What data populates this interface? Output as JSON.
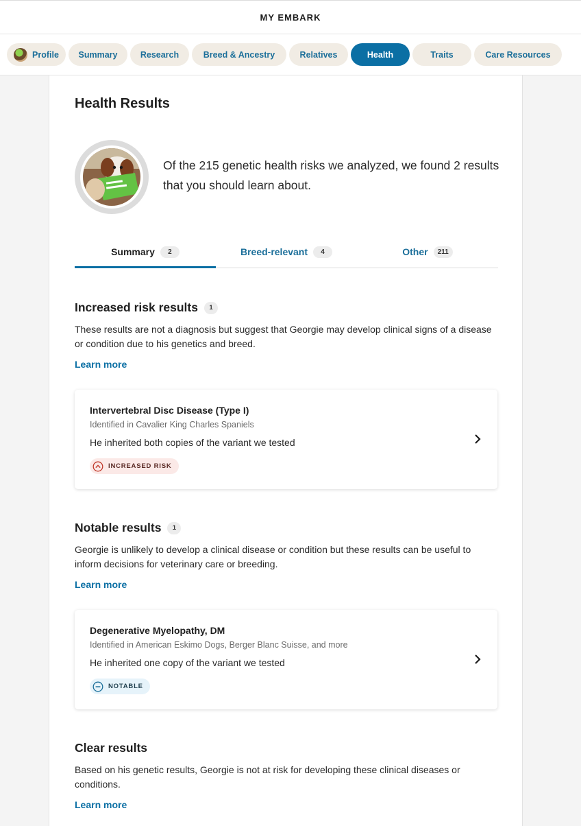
{
  "header": {
    "title": "MY EMBARK"
  },
  "nav": {
    "items": [
      {
        "label": "Profile"
      },
      {
        "label": "Summary"
      },
      {
        "label": "Research"
      },
      {
        "label": "Breed & Ancestry"
      },
      {
        "label": "Relatives"
      },
      {
        "label": "Health"
      },
      {
        "label": "Traits"
      },
      {
        "label": "Care Resources"
      }
    ],
    "active": "Health"
  },
  "page": {
    "title": "Health Results",
    "intro": "Of the 215 genetic health risks we analyzed, we found 2 results that you should learn about."
  },
  "tabs": [
    {
      "label": "Summary",
      "count": "2"
    },
    {
      "label": "Breed-relevant",
      "count": "4"
    },
    {
      "label": "Other",
      "count": "211"
    }
  ],
  "sections": {
    "increased": {
      "title": "Increased risk results",
      "count": "1",
      "description": "These results are not a diagnosis but suggest that Georgie may develop clinical signs of a disease or condition due to his genetics and breed.",
      "learn_more": "Learn more",
      "card": {
        "title": "Intervertebral Disc Disease (Type I)",
        "identified": "Identified in Cavalier King Charles Spaniels",
        "detail": "He inherited both copies of the variant we tested",
        "badge": "INCREASED RISK"
      }
    },
    "notable": {
      "title": "Notable results",
      "count": "1",
      "description": "Georgie is unlikely to develop a clinical disease or condition but these results can be useful to inform decisions for veterinary care or breeding.",
      "learn_more": "Learn more",
      "card": {
        "title": "Degenerative Myelopathy, DM",
        "identified": "Identified in American Eskimo Dogs, Berger Blanc Suisse, and more",
        "detail": "He inherited one copy of the variant we tested",
        "badge": "NOTABLE"
      }
    },
    "clear": {
      "title": "Clear results",
      "description": "Based on his genetic results, Georgie is not at risk for developing these clinical diseases or conditions.",
      "learn_more": "Learn more"
    }
  },
  "colors": {
    "accent": "#0b6fa4",
    "pill_bg": "#f1ece4",
    "risk_bg": "#fbe9e7",
    "risk_icon": "#c0392b",
    "notable_bg": "#e6f3fa",
    "notable_icon": "#1c6f9a"
  },
  "icons": [
    "dog-avatar-icon",
    "chevron-right-icon",
    "chevron-up-circle-icon",
    "minus-circle-icon"
  ]
}
